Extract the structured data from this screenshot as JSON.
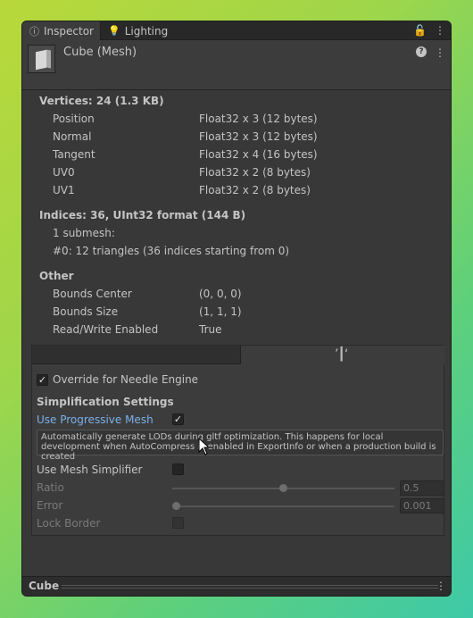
{
  "tabs": [
    {
      "label": "Inspector",
      "icon": "info-icon"
    },
    {
      "label": "Lighting",
      "icon": "lightbulb-icon"
    }
  ],
  "header": {
    "title": "Cube (Mesh)"
  },
  "vertices": {
    "heading": "Vertices: 24 (1.3 KB)",
    "rows": [
      {
        "label": "Position",
        "value": "Float32 x 3 (12 bytes)"
      },
      {
        "label": "Normal",
        "value": "Float32 x 3 (12 bytes)"
      },
      {
        "label": "Tangent",
        "value": "Float32 x 4 (16 bytes)"
      },
      {
        "label": "UV0",
        "value": "Float32 x 2 (8 bytes)"
      },
      {
        "label": "UV1",
        "value": "Float32 x 2 (8 bytes)"
      }
    ]
  },
  "indices": {
    "heading": "Indices: 36, UInt32 format (144 B)",
    "submesh": "1 submesh:",
    "detail": "#0: 12 triangles (36 indices starting from 0)"
  },
  "other": {
    "heading": "Other",
    "rows": [
      {
        "label": "Bounds Center",
        "value": "(0, 0, 0)"
      },
      {
        "label": "Bounds Size",
        "value": "(1, 1, 1)"
      },
      {
        "label": "Read/Write Enabled",
        "value": "True"
      }
    ]
  },
  "needle": {
    "override_label": "Override for Needle Engine",
    "override_checked": true,
    "simplification_heading": "Simplification Settings",
    "progressive_label": "Use Progressive Mesh",
    "progressive_checked": true,
    "help_text": "Automatically generate LODs during gltf optimization. This happens for local development when AutoCompress is enabled in ExportInfo or when a production build is created",
    "mesh_simplifier_label": "Use Mesh Simplifier",
    "mesh_simplifier_checked": false,
    "ratio_label": "Ratio",
    "ratio_value": "0.5",
    "ratio_fraction": 0.5,
    "error_label": "Error",
    "error_value": "0.001",
    "error_fraction": 0.001,
    "lock_border_label": "Lock Border",
    "lock_border_checked": false
  },
  "footer": {
    "label": "Cube"
  },
  "colors": {
    "accent_link": "#7ab0e8",
    "panel_bg": "#383838"
  }
}
